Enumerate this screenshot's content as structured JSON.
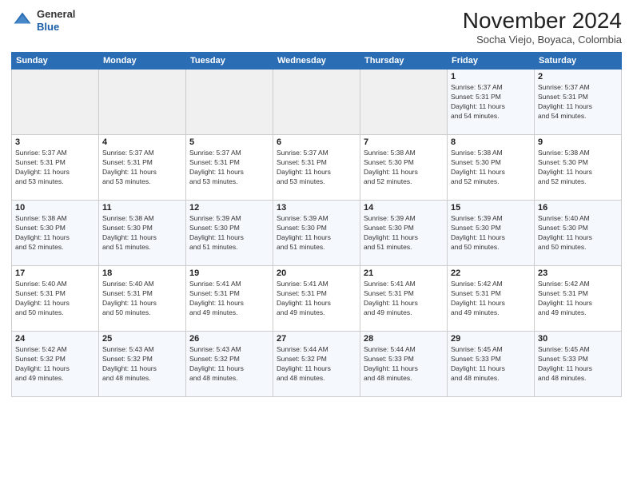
{
  "header": {
    "logo_line1": "General",
    "logo_line2": "Blue",
    "month_title": "November 2024",
    "subtitle": "Socha Viejo, Boyaca, Colombia"
  },
  "weekdays": [
    "Sunday",
    "Monday",
    "Tuesday",
    "Wednesday",
    "Thursday",
    "Friday",
    "Saturday"
  ],
  "weeks": [
    [
      {
        "day": "",
        "info": ""
      },
      {
        "day": "",
        "info": ""
      },
      {
        "day": "",
        "info": ""
      },
      {
        "day": "",
        "info": ""
      },
      {
        "day": "",
        "info": ""
      },
      {
        "day": "1",
        "info": "Sunrise: 5:37 AM\nSunset: 5:31 PM\nDaylight: 11 hours\nand 54 minutes."
      },
      {
        "day": "2",
        "info": "Sunrise: 5:37 AM\nSunset: 5:31 PM\nDaylight: 11 hours\nand 54 minutes."
      }
    ],
    [
      {
        "day": "3",
        "info": "Sunrise: 5:37 AM\nSunset: 5:31 PM\nDaylight: 11 hours\nand 53 minutes."
      },
      {
        "day": "4",
        "info": "Sunrise: 5:37 AM\nSunset: 5:31 PM\nDaylight: 11 hours\nand 53 minutes."
      },
      {
        "day": "5",
        "info": "Sunrise: 5:37 AM\nSunset: 5:31 PM\nDaylight: 11 hours\nand 53 minutes."
      },
      {
        "day": "6",
        "info": "Sunrise: 5:37 AM\nSunset: 5:31 PM\nDaylight: 11 hours\nand 53 minutes."
      },
      {
        "day": "7",
        "info": "Sunrise: 5:38 AM\nSunset: 5:30 PM\nDaylight: 11 hours\nand 52 minutes."
      },
      {
        "day": "8",
        "info": "Sunrise: 5:38 AM\nSunset: 5:30 PM\nDaylight: 11 hours\nand 52 minutes."
      },
      {
        "day": "9",
        "info": "Sunrise: 5:38 AM\nSunset: 5:30 PM\nDaylight: 11 hours\nand 52 minutes."
      }
    ],
    [
      {
        "day": "10",
        "info": "Sunrise: 5:38 AM\nSunset: 5:30 PM\nDaylight: 11 hours\nand 52 minutes."
      },
      {
        "day": "11",
        "info": "Sunrise: 5:38 AM\nSunset: 5:30 PM\nDaylight: 11 hours\nand 51 minutes."
      },
      {
        "day": "12",
        "info": "Sunrise: 5:39 AM\nSunset: 5:30 PM\nDaylight: 11 hours\nand 51 minutes."
      },
      {
        "day": "13",
        "info": "Sunrise: 5:39 AM\nSunset: 5:30 PM\nDaylight: 11 hours\nand 51 minutes."
      },
      {
        "day": "14",
        "info": "Sunrise: 5:39 AM\nSunset: 5:30 PM\nDaylight: 11 hours\nand 51 minutes."
      },
      {
        "day": "15",
        "info": "Sunrise: 5:39 AM\nSunset: 5:30 PM\nDaylight: 11 hours\nand 50 minutes."
      },
      {
        "day": "16",
        "info": "Sunrise: 5:40 AM\nSunset: 5:30 PM\nDaylight: 11 hours\nand 50 minutes."
      }
    ],
    [
      {
        "day": "17",
        "info": "Sunrise: 5:40 AM\nSunset: 5:31 PM\nDaylight: 11 hours\nand 50 minutes."
      },
      {
        "day": "18",
        "info": "Sunrise: 5:40 AM\nSunset: 5:31 PM\nDaylight: 11 hours\nand 50 minutes."
      },
      {
        "day": "19",
        "info": "Sunrise: 5:41 AM\nSunset: 5:31 PM\nDaylight: 11 hours\nand 49 minutes."
      },
      {
        "day": "20",
        "info": "Sunrise: 5:41 AM\nSunset: 5:31 PM\nDaylight: 11 hours\nand 49 minutes."
      },
      {
        "day": "21",
        "info": "Sunrise: 5:41 AM\nSunset: 5:31 PM\nDaylight: 11 hours\nand 49 minutes."
      },
      {
        "day": "22",
        "info": "Sunrise: 5:42 AM\nSunset: 5:31 PM\nDaylight: 11 hours\nand 49 minutes."
      },
      {
        "day": "23",
        "info": "Sunrise: 5:42 AM\nSunset: 5:31 PM\nDaylight: 11 hours\nand 49 minutes."
      }
    ],
    [
      {
        "day": "24",
        "info": "Sunrise: 5:42 AM\nSunset: 5:32 PM\nDaylight: 11 hours\nand 49 minutes."
      },
      {
        "day": "25",
        "info": "Sunrise: 5:43 AM\nSunset: 5:32 PM\nDaylight: 11 hours\nand 48 minutes."
      },
      {
        "day": "26",
        "info": "Sunrise: 5:43 AM\nSunset: 5:32 PM\nDaylight: 11 hours\nand 48 minutes."
      },
      {
        "day": "27",
        "info": "Sunrise: 5:44 AM\nSunset: 5:32 PM\nDaylight: 11 hours\nand 48 minutes."
      },
      {
        "day": "28",
        "info": "Sunrise: 5:44 AM\nSunset: 5:33 PM\nDaylight: 11 hours\nand 48 minutes."
      },
      {
        "day": "29",
        "info": "Sunrise: 5:45 AM\nSunset: 5:33 PM\nDaylight: 11 hours\nand 48 minutes."
      },
      {
        "day": "30",
        "info": "Sunrise: 5:45 AM\nSunset: 5:33 PM\nDaylight: 11 hours\nand 48 minutes."
      }
    ]
  ]
}
